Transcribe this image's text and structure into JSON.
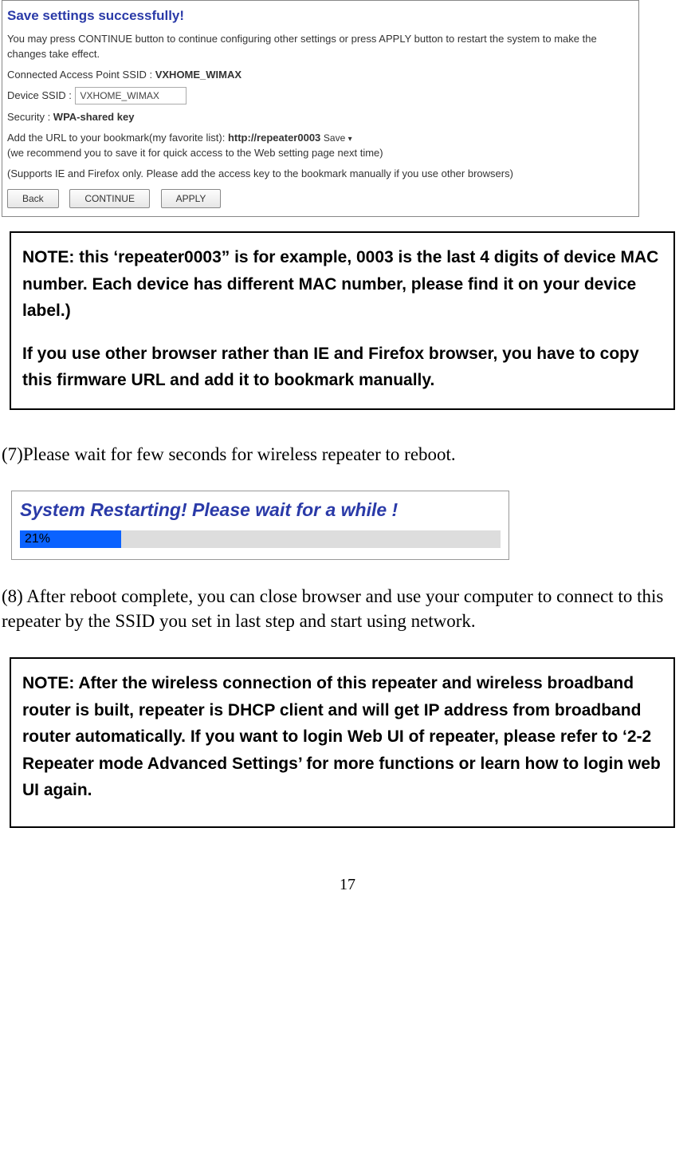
{
  "settings": {
    "title": "Save settings successfully!",
    "intro": "You may press CONTINUE button to continue configuring other settings or press APPLY button to restart the system to make the changes take effect.",
    "connected_label": "Connected Access Point SSID : ",
    "connected_value": "VXHOME_WIMAX",
    "device_label": "Device SSID : ",
    "device_value": "VXHOME_WIMAX",
    "security_label": "Security : ",
    "security_value": "WPA-shared key",
    "bookmark_pre": "Add the URL to your bookmark(my favorite list): ",
    "bookmark_url": "http://repeater0003",
    "save_label": "Save",
    "bookmark_post": "(we recommend you to save it for quick access to the Web setting page next time)",
    "supports": "(Supports IE and Firefox only. Please add the access key to the bookmark manually if you use other browsers)",
    "btn_back": "Back",
    "btn_continue": "CONTINUE",
    "btn_apply": "APPLY"
  },
  "note1_a": "NOTE: this ‘repeater0003” is for example, 0003 is the last 4 digits of device MAC number. Each device has different MAC number, please find it on your device label.)",
  "note1_b": "If you use other browser rather than IE and Firefox browser, you have to copy this firmware URL and add it to bookmark manually.",
  "step7": "(7)Please wait for few seconds for wireless repeater to reboot.",
  "restart": {
    "title": "System Restarting! Please wait for a while !",
    "percent_label": "21%",
    "percent_value": 21
  },
  "step8": "(8) After reboot complete, you can close browser and use your computer to connect to this repeater by the SSID you set in last step and start using network.",
  "note2": "NOTE: After the wireless connection of this repeater and wireless broadband router is built, repeater is DHCP client and will get IP address from broadband router automatically. If you want to login Web UI of repeater, please refer to ‘2-2 Repeater mode Advanced Settings’ for more functions or learn how to login web UI again.",
  "page_number": "17"
}
